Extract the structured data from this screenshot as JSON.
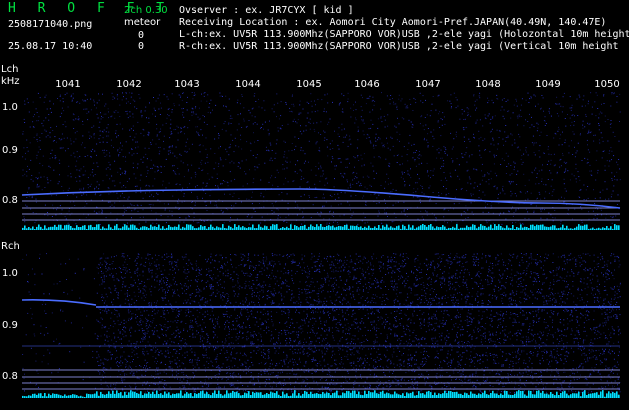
{
  "header": {
    "brand": "H R O F F T",
    "version": "2ch 0.30",
    "filename": "2508171040.png",
    "meteor_label": "meteor",
    "count_left": "0",
    "datetime": "25.08.17 10:40",
    "count_right": "0",
    "observer": "Ovserver              : ex. JR7CYX [ kid ]",
    "location": "Receiving Location : ex. Aomori City Aomori-Pref.JAPAN(40.49N, 140.47E)",
    "lch_desc": "L-ch:ex. UV5R 113.900Mhz(SAPPORO VOR)USB ,2-ele yagi (Holozontal 10m height",
    "rch_desc": "R-ch:ex. UV5R 113.900Mhz(SAPPORO VOR)USB ,2-ele yagi (Vertical 10m height"
  },
  "lch_panel": {
    "channel": "Lch",
    "unit": "kHz",
    "y_ticks": [
      "1.0",
      "0.9",
      "0.8"
    ]
  },
  "rch_panel": {
    "channel": "Rch",
    "y_ticks": [
      "1.0",
      "0.9",
      "0.8"
    ]
  },
  "x_ticks": [
    "1041",
    "1042",
    "1043",
    "1044",
    "1045",
    "1046",
    "1047",
    "1048",
    "1049",
    "1050"
  ],
  "colors": {
    "background": "#000000",
    "noise": "#2a34c8",
    "signal_trace": "#4a6cff",
    "level_bars": "#00e0ff",
    "header_green": "#00e040"
  }
}
